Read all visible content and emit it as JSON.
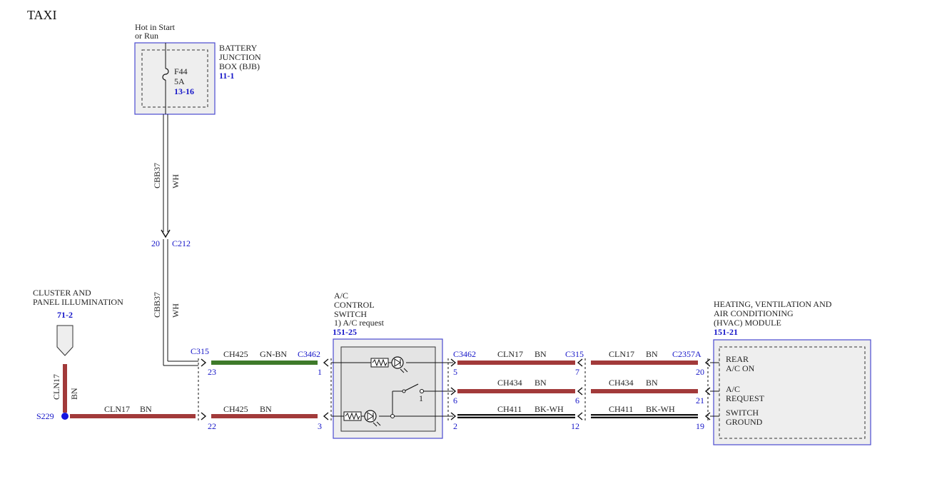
{
  "title": "TAXI",
  "bjb": {
    "feed": [
      "Hot in Start",
      "or Run"
    ],
    "name": [
      "BATTERY",
      "JUNCTION",
      "BOX (BJB)"
    ],
    "ref": "11-1",
    "fuse": "F44",
    "rating": "5A",
    "fuse_ref": "13-16"
  },
  "cluster": {
    "name": [
      "CLUSTER AND",
      "PANEL ILLUMINATION"
    ],
    "ref": "71-2"
  },
  "ac_switch": {
    "name": [
      "A/C",
      "CONTROL",
      "SWITCH",
      "1) A/C request"
    ],
    "ref": "151-25",
    "pin": "1"
  },
  "hvac": {
    "name": [
      "HEATING, VENTILATION AND",
      "AIR CONDITIONING",
      "(HVAC) MODULE"
    ],
    "ref": "151-21",
    "labels": {
      "rear": [
        "REAR",
        "A/C ON"
      ],
      "req": [
        "A/C",
        "REQUEST"
      ],
      "gnd": [
        "SWITCH",
        "GROUND"
      ]
    }
  },
  "splice": "S229",
  "connectors": {
    "c212": "C212",
    "c212_pin": "20",
    "c315_left": "C315",
    "c315_pin_top": "23",
    "c315_pin_bot": "22",
    "c3462_left": "C3462",
    "c3462_left_pin_top": "1",
    "c3462_left_pin_bot": "3",
    "c3462_right": "C3462",
    "c3462_right_pins": [
      "5",
      "6",
      "2"
    ],
    "c315_right": "C315",
    "c315_right_pins": [
      "7",
      "6",
      "12"
    ],
    "c2357a": "C2357A",
    "c2357a_pins": [
      "20",
      "21",
      "19"
    ]
  },
  "wires": {
    "cbb37_upper": {
      "circuit": "CBB37",
      "color": "WH"
    },
    "cbb37_lower": {
      "circuit": "CBB37",
      "color": "WH"
    },
    "cln17_vertical": {
      "circuit": "CLN17",
      "color": "BN"
    },
    "cln17_left": {
      "circuit": "CLN17",
      "color": "BN"
    },
    "ch425_top": {
      "circuit": "CH425",
      "color": "GN-BN"
    },
    "ch425_bot": {
      "circuit": "CH425",
      "color": "BN"
    },
    "r1a": {
      "circuit": "CLN17",
      "color": "BN"
    },
    "r1b": {
      "circuit": "CLN17",
      "color": "BN"
    },
    "r2a": {
      "circuit": "CH434",
      "color": "BN"
    },
    "r2b": {
      "circuit": "CH434",
      "color": "BN"
    },
    "r3a": {
      "circuit": "CH411",
      "color": "BK-WH"
    },
    "r3b": {
      "circuit": "CH411",
      "color": "BK-WH"
    }
  },
  "colors": {
    "brown": "#a23a3a",
    "green": "#3e7a2a",
    "black": "#111111",
    "box_border": "#4a4ad0",
    "ref_text": "#1515c8"
  }
}
